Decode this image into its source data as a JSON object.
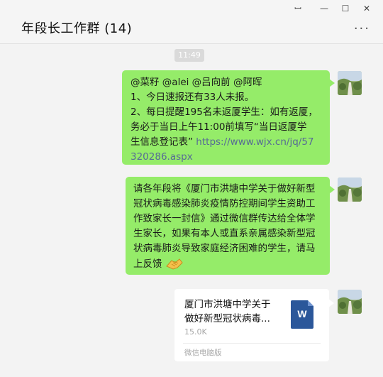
{
  "window": {
    "title": "年段长工作群 (14)",
    "controls": {
      "pin": "ꟷ",
      "minimize": "—",
      "maximize": "☐",
      "close": "✕"
    },
    "more_label": "···"
  },
  "chat": {
    "timestamp": "11:49",
    "messages": [
      {
        "type": "text",
        "lines": [
          "@菜籽 @alei @吕向前 @阿晖",
          "1、今日速报还有33人未报。",
          "2、每日提醒195名未返厦学生：如有返厦，",
          "务必于当日上午11:00前填写“当日返厦学",
          "生信息登记表” "
        ],
        "link_part1": "https://www.wjx.cn/jq/57",
        "link_part2": "320286.aspx"
      },
      {
        "type": "text",
        "lines": [
          "请各年段将《厦门市洪塘中学关于做好新型",
          "冠状病毒感染肺炎疫情防控期间学生资助工",
          "作致家长一封信》通过微信群传达给全体学",
          "生家长，如果有本人或直系亲属感染新型冠",
          "状病毒肺炎导致家庭经济困难的学生，请马",
          "上反馈"
        ],
        "emoji": "handshake"
      },
      {
        "type": "file",
        "name_line1": "厦门市洪塘中学关于",
        "name_line2": "做好新型冠状病毒...",
        "size": "15.0K",
        "source": "微信电脑版",
        "icon": "word-file-icon",
        "icon_letter": "W"
      }
    ]
  },
  "colors": {
    "bubble_green": "#95ec69",
    "link": "#576b95",
    "word_blue": "#2b579a"
  }
}
